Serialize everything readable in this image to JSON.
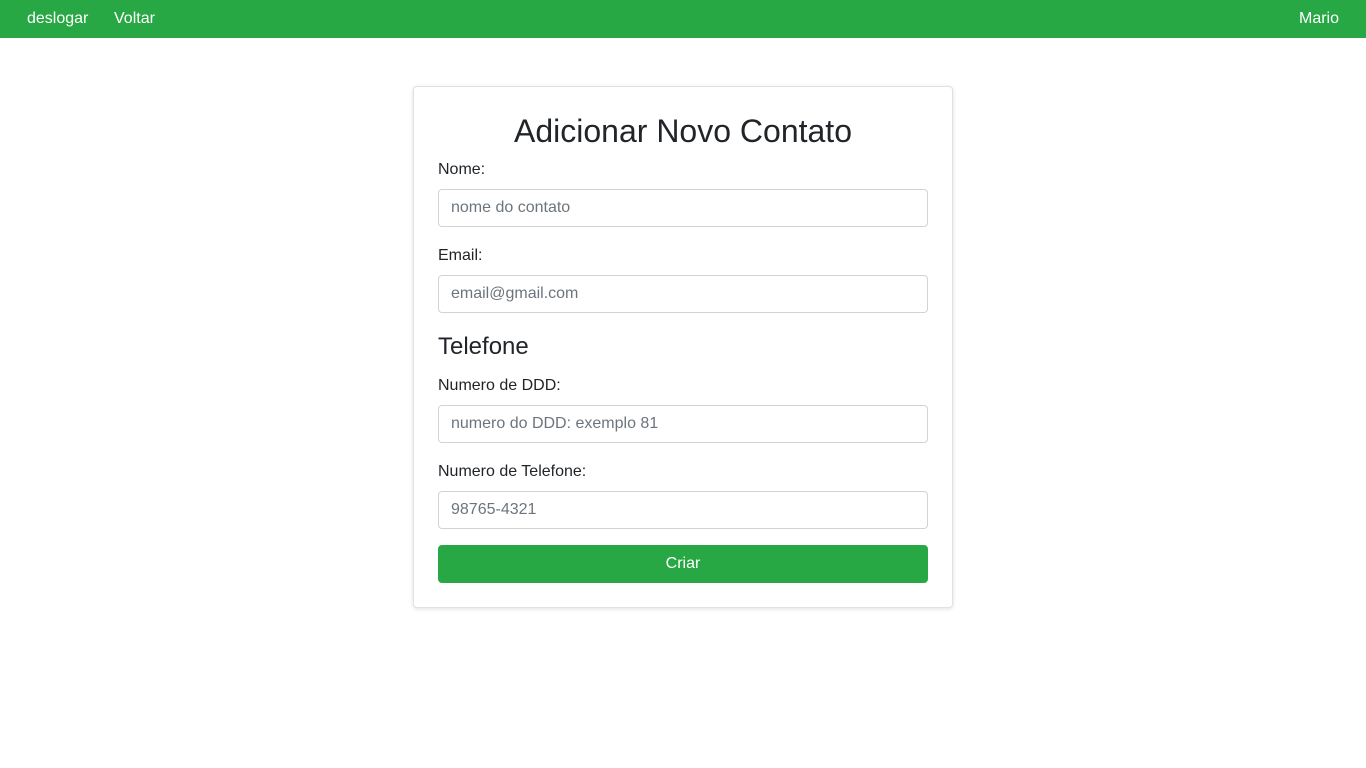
{
  "navbar": {
    "logout_label": "deslogar",
    "back_label": "Voltar",
    "user_name": "Mario",
    "background_color": "#28a745"
  },
  "form": {
    "title": "Adicionar Novo Contato",
    "name": {
      "label": "Nome:",
      "placeholder": "nome do contato",
      "value": ""
    },
    "email": {
      "label": "Email:",
      "placeholder": "email@gmail.com",
      "value": ""
    },
    "phone_section_title": "Telefone",
    "ddd": {
      "label": "Numero de DDD:",
      "placeholder": "numero do DDD: exemplo 81",
      "value": ""
    },
    "phone": {
      "label": "Numero de Telefone:",
      "placeholder": "98765-4321",
      "value": ""
    },
    "submit_label": "Criar",
    "accent_color": "#28a745"
  }
}
